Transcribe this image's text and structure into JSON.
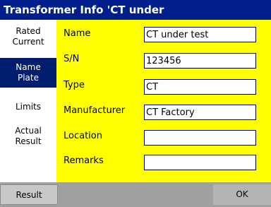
{
  "window": {
    "title": "Transformer Info 'CT under"
  },
  "sidebar": {
    "tabs": [
      {
        "lines": [
          "Rated",
          "Current"
        ],
        "selected": false
      },
      {
        "lines": [
          "Name",
          "Plate"
        ],
        "selected": true
      },
      {
        "lines": [
          "Limits"
        ],
        "selected": false
      },
      {
        "lines": [
          "Actual",
          "Result"
        ],
        "selected": false
      }
    ]
  },
  "form": {
    "fields": [
      {
        "label": "Name",
        "value": "CT under test"
      },
      {
        "label": "S/N",
        "value": "123456"
      },
      {
        "label": "Type",
        "value": "CT"
      },
      {
        "label": "Manufacturer",
        "value": "CT Factory"
      },
      {
        "label": "Location",
        "value": ""
      },
      {
        "label": "Remarks",
        "value": ""
      }
    ]
  },
  "footer": {
    "result_label": "Result",
    "ok_label": "OK"
  },
  "colors": {
    "titlebar": "#001e8c",
    "form_background": "#ffff00",
    "selected_tab": "#001e6e",
    "bottombar": "#a0a0a0"
  }
}
